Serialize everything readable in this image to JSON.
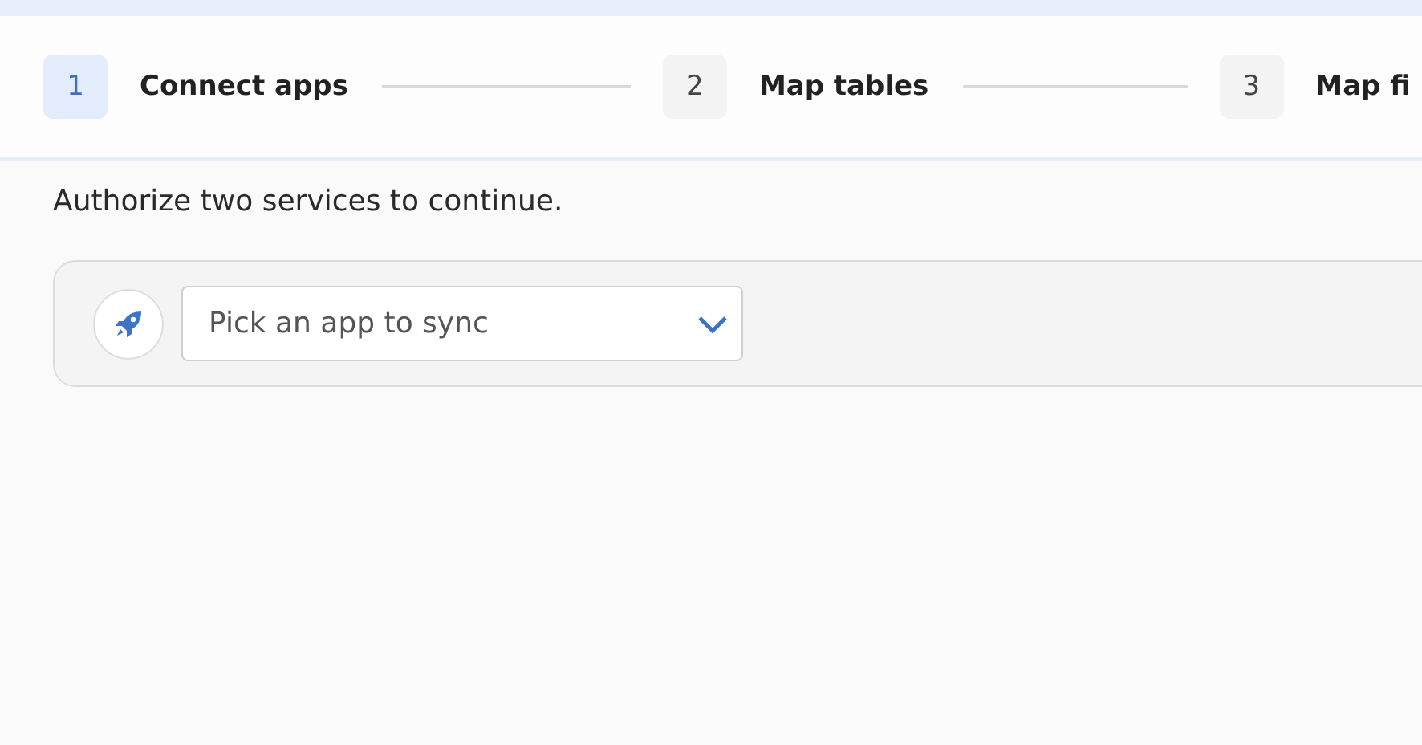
{
  "steps": [
    {
      "number": "1",
      "label": "Connect apps",
      "selected": true
    },
    {
      "number": "2",
      "label": "Map tables",
      "selected": false
    },
    {
      "number": "3",
      "label": "Map fi",
      "selected": false
    }
  ],
  "instruction": "Authorize two services to continue.",
  "app_picker": {
    "placeholder": "Pick an app to sync"
  }
}
